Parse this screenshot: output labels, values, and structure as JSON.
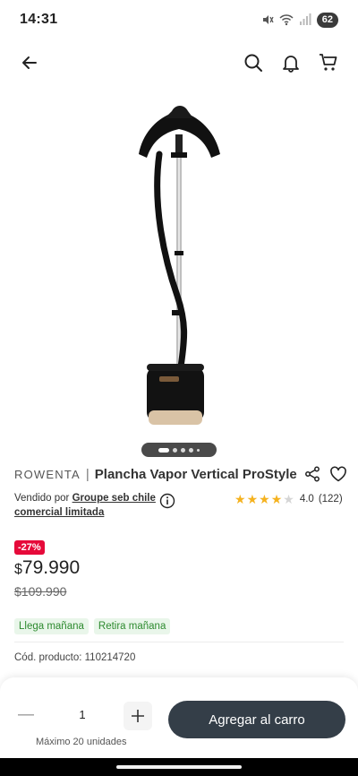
{
  "status_bar": {
    "time": "14:31",
    "battery": "62"
  },
  "header": {
    "back_icon": "arrow-left-icon",
    "search_icon": "search-icon",
    "notifications_icon": "bell-icon",
    "cart_icon": "cart-icon"
  },
  "carousel": {
    "total_dots": 5,
    "active_index": 0
  },
  "product": {
    "brand": "ROWENTA",
    "separator": "|",
    "name": "Plancha Vapor Vertical ProStyle",
    "share_icon": "share-icon",
    "favorite_icon": "heart-icon",
    "seller_prefix": "Vendido por",
    "seller_name": "Groupe seb chile comercial limitada",
    "rating_value": "4.0",
    "rating_count": "(122)",
    "rating_stars": 4,
    "discount": "-27%",
    "price_currency": "$",
    "price_now": "79.990",
    "price_old": "$109.990",
    "badge_delivery": "Llega mañana",
    "badge_pickup": "Retira mañana",
    "sku_label": "Cód. producto: 110214720"
  },
  "purchase": {
    "quantity": "1",
    "max_units": "Máximo 20 unidades",
    "add_to_cart": "Agregar al carro"
  },
  "colors": {
    "accent": "#343e48",
    "discount": "#e60a3a",
    "badge_bg": "#e9f6ea",
    "badge_text": "#2d8a2f",
    "star": "#f5b21e"
  }
}
